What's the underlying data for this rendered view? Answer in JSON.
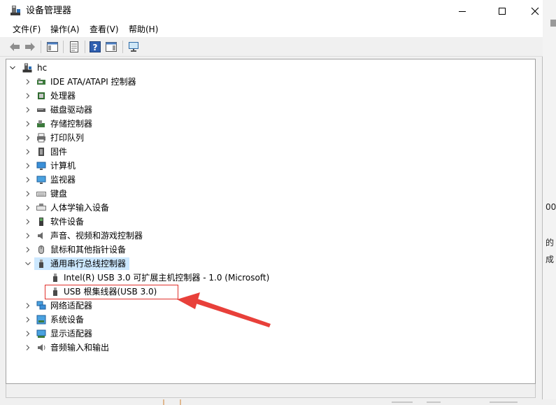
{
  "window": {
    "title": "设备管理器",
    "controls": {
      "minimize": "minimize-icon",
      "maximize": "maximize-icon",
      "close": "close-icon"
    }
  },
  "menu": [
    {
      "label": "文件(F)"
    },
    {
      "label": "操作(A)"
    },
    {
      "label": "查看(V)"
    },
    {
      "label": "帮助(H)"
    }
  ],
  "toolbar": {
    "buttons": [
      "back-icon",
      "forward-icon",
      "show-hide-console-tree-icon",
      "properties-icon",
      "help-icon",
      "action-pane-icon",
      "monitor-icon"
    ]
  },
  "tree": {
    "root": "hc",
    "categories": [
      {
        "label": "IDE ATA/ATAPI 控制器",
        "icon": "ide-controller-icon"
      },
      {
        "label": "处理器",
        "icon": "processor-icon"
      },
      {
        "label": "磁盘驱动器",
        "icon": "disk-drive-icon"
      },
      {
        "label": "存储控制器",
        "icon": "storage-controller-icon"
      },
      {
        "label": "打印队列",
        "icon": "printer-icon"
      },
      {
        "label": "固件",
        "icon": "firmware-icon"
      },
      {
        "label": "计算机",
        "icon": "computer-icon"
      },
      {
        "label": "监视器",
        "icon": "monitor-icon"
      },
      {
        "label": "键盘",
        "icon": "keyboard-icon"
      },
      {
        "label": "人体学输入设备",
        "icon": "hid-icon"
      },
      {
        "label": "软件设备",
        "icon": "software-device-icon"
      },
      {
        "label": "声音、视频和游戏控制器",
        "icon": "sound-icon"
      },
      {
        "label": "鼠标和其他指针设备",
        "icon": "mouse-icon"
      },
      {
        "label": "通用串行总线控制器",
        "icon": "usb-icon",
        "expanded": true,
        "selected": true
      },
      {
        "label": "网络适配器",
        "icon": "network-adapter-icon"
      },
      {
        "label": "系统设备",
        "icon": "system-device-icon"
      },
      {
        "label": "显示适配器",
        "icon": "display-adapter-icon"
      },
      {
        "label": "音频输入和输出",
        "icon": "audio-io-icon"
      }
    ],
    "usb_children": [
      {
        "label": "Intel(R) USB 3.0 可扩展主机控制器 - 1.0 (Microsoft)"
      },
      {
        "label": "USB 根集线器(USB 3.0)",
        "highlighted": true
      }
    ]
  },
  "background_fragments": {
    "right": [
      "00",
      "的",
      "成"
    ]
  },
  "colors": {
    "selection": "#cce8ff",
    "highlight_box": "#e0312c",
    "annotation_arrow": "#e8403a"
  }
}
